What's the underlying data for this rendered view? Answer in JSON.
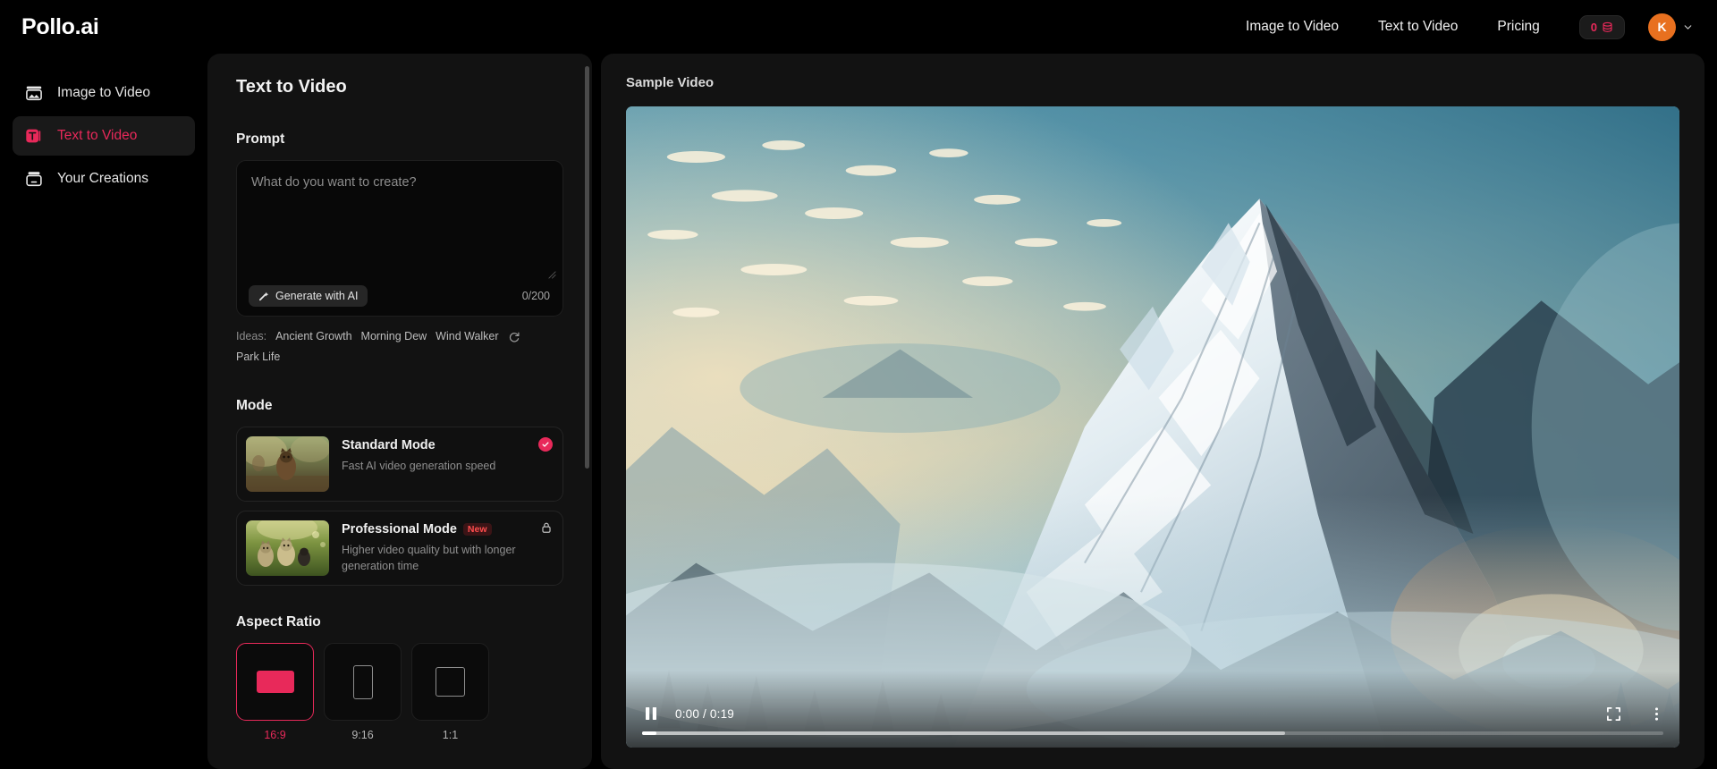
{
  "header": {
    "logo": "Pollo.ai",
    "nav": [
      {
        "label": "Image to Video"
      },
      {
        "label": "Text to Video"
      },
      {
        "label": "Pricing"
      }
    ],
    "credits": "0",
    "credits_icon": "coin-icon",
    "avatar_initial": "K",
    "chevron_icon": "chevron-down-icon"
  },
  "sidebar": {
    "items": [
      {
        "label": "Image to Video",
        "icon": "image-icon",
        "active": false
      },
      {
        "label": "Text to Video",
        "icon": "text-icon",
        "active": true
      },
      {
        "label": "Your Creations",
        "icon": "creations-folder-icon",
        "active": false
      }
    ]
  },
  "panel": {
    "title": "Text to Video",
    "prompt": {
      "label": "Prompt",
      "value": "",
      "placeholder": "What do you want to create?",
      "generate_button": "Generate with AI",
      "generate_icon": "magic-wand-icon",
      "char_count": "0/200"
    },
    "ideas": {
      "label": "Ideas:",
      "chips": [
        "Ancient Growth",
        "Morning Dew",
        "Wind Walker",
        "Park Life"
      ],
      "refresh_icon": "refresh-icon"
    },
    "mode": {
      "label": "Mode",
      "options": [
        {
          "title": "Standard Mode",
          "desc": "Fast AI video generation speed",
          "badge": "",
          "selected": true,
          "locked": false,
          "thumb": "dog-running-trail"
        },
        {
          "title": "Professional Mode",
          "desc": "Higher video quality but with longer generation time",
          "badge": "New",
          "selected": false,
          "locked": true,
          "thumb": "three-dogs-grass"
        }
      ]
    },
    "aspect_ratio": {
      "label": "Aspect Ratio",
      "options": [
        {
          "label": "16:9",
          "selected": true
        },
        {
          "label": "9:16",
          "selected": false
        },
        {
          "label": "1:1",
          "selected": false
        }
      ]
    }
  },
  "stage": {
    "title": "Sample Video",
    "player": {
      "play_state": "playing",
      "pause_icon": "pause-icon",
      "time": "0:00 / 0:19",
      "current_time": "0:00",
      "duration": "0:19",
      "progress_percent": 1.4,
      "buffered_percent": 63,
      "fullscreen_icon": "fullscreen-icon",
      "more_icon": "more-vertical-icon"
    },
    "scene_description": "Snow-capped mountain peak at sunrise with clouds"
  },
  "colors": {
    "accent": "#e8295a",
    "background": "#000000",
    "panel": "#121212",
    "avatar": "#e8701f",
    "new_badge_text": "#ff4d4d"
  }
}
